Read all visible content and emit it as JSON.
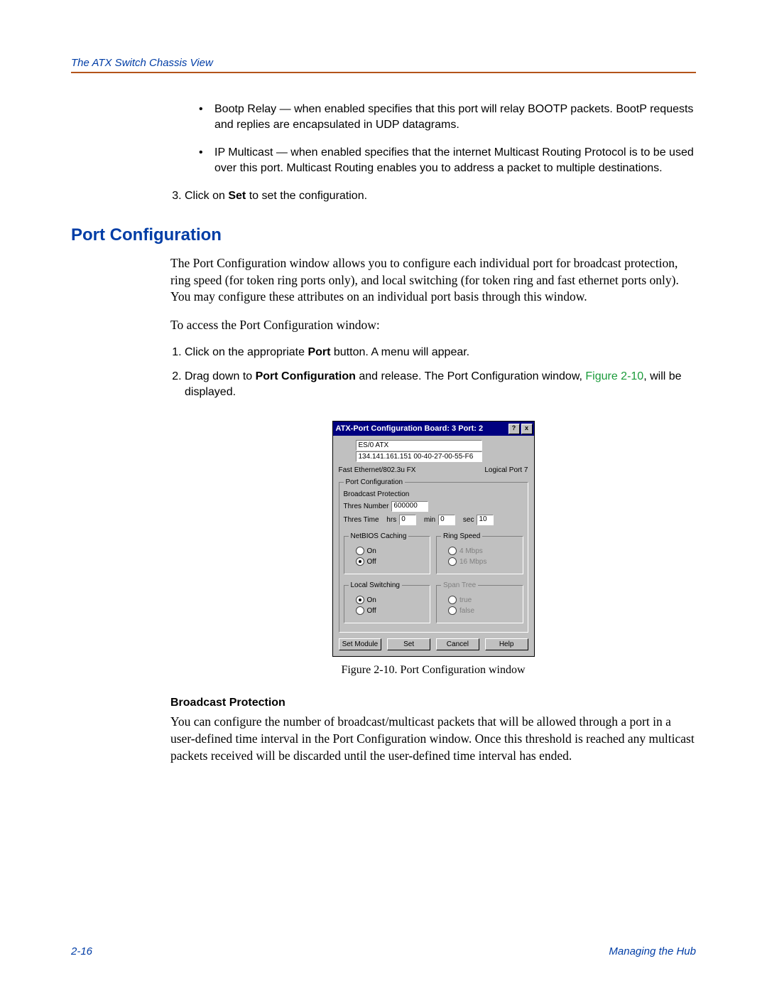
{
  "header": {
    "title": "The ATX Switch Chassis View"
  },
  "bullets": [
    {
      "term": "Bootp Relay",
      "text": " — when enabled specifies that this port will relay BOOTP packets. BootP requests and replies are encapsulated in UDP datagrams."
    },
    {
      "term": "IP Multicast",
      "text": " — when enabled specifies that the internet Multicast Routing Protocol is to be used over this port. Multicast Routing enables you to address a packet to multiple destinations."
    }
  ],
  "step3": {
    "prefix": "Click on ",
    "bold": "Set",
    "suffix": " to set the configuration."
  },
  "section": {
    "title": "Port Configuration"
  },
  "intro": "The Port Configuration window allows you to configure each individual port for broadcast protection, ring speed (for token ring ports only), and local switching (for token ring and fast ethernet ports only). You may configure these attributes on an individual port basis through this window.",
  "access": "To access the Port Configuration window:",
  "ol": {
    "s1": {
      "prefix": "Click on the appropriate ",
      "bold": "Port",
      "suffix": " button. A menu will appear."
    },
    "s2": {
      "prefix": "Drag down to ",
      "bold": "Port Configuration",
      "mid": " and release. The Port Configuration window, ",
      "link": "Figure 2-10",
      "suffix": ", will be displayed."
    }
  },
  "win": {
    "title": "ATX-Port Configuration  Board: 3  Port: 2",
    "help": "?",
    "close": "x",
    "name": "ES/0 ATX",
    "ipmac": "134.141.161.151  00-40-27-00-55-F6",
    "media": "Fast Ethernet/802.3u FX",
    "logical": "Logical Port 7",
    "pc_legend": "Port Configuration",
    "bp_label": "Broadcast Protection",
    "thres_num_label": "Thres Number",
    "thres_num_value": "600000",
    "thres_time_label": "Thres Time",
    "hrs_label": "hrs",
    "hrs_value": "0",
    "min_label": "min",
    "min_value": "0",
    "sec_label": "sec",
    "sec_value": "10",
    "netbios_legend": "NetBIOS Caching",
    "on": "On",
    "off": "Off",
    "ringspeed_legend": "Ring Speed",
    "rs_opt1": "4 Mbps",
    "rs_opt2": "16 Mbps",
    "local_legend": "Local Switching",
    "spantree_legend": "Span Tree",
    "st_opt1": "true",
    "st_opt2": "false",
    "btn_setmod": "Set Module",
    "btn_set": "Set",
    "btn_cancel": "Cancel",
    "btn_help": "Help"
  },
  "caption": "Figure 2-10. Port Configuration window",
  "bp": {
    "heading": "Broadcast Protection",
    "text": "You can configure the number of broadcast/multicast packets that will be allowed through a port in a user-defined time interval in the Port Configuration window. Once this threshold is reached any multicast packets received will be discarded until the user-defined time interval has ended."
  },
  "footer": {
    "page": "2-16",
    "section": "Managing the Hub"
  }
}
